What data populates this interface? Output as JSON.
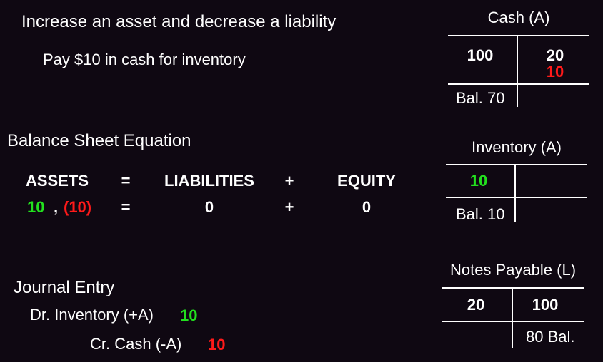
{
  "heading": "Increase an asset and decrease a liability",
  "transaction": "Pay $10 in cash for inventory",
  "equation": {
    "title": "Balance Sheet Equation",
    "headers": [
      "ASSETS",
      "=",
      "LIABILITIES",
      "+",
      "EQUITY"
    ],
    "assets_increase": "10",
    "comma": ",",
    "assets_decrease": "(10)",
    "eq_sign": "=",
    "liabilities": "0",
    "plus_sign": "+",
    "equity": "0"
  },
  "journal": {
    "title": "Journal Entry",
    "debit_label": "Dr. Inventory (+A)",
    "debit_amount": "10",
    "credit_label": "Cr. Cash (-A)",
    "credit_amount": "10"
  },
  "t_accounts": {
    "cash": {
      "title": "Cash (A)",
      "debit": "100",
      "credit_1": "20",
      "credit_2": "10",
      "balance": "Bal. 70"
    },
    "inventory": {
      "title": "Inventory (A)",
      "debit": "10",
      "balance": "Bal. 10"
    },
    "notes_payable": {
      "title": "Notes Payable (L)",
      "debit": "20",
      "credit": "100",
      "balance": "80 Bal."
    }
  },
  "colors": {
    "background": "#0f0812",
    "text": "#ffffff",
    "increase": "#22e01e",
    "decrease": "#ff1a1a"
  }
}
